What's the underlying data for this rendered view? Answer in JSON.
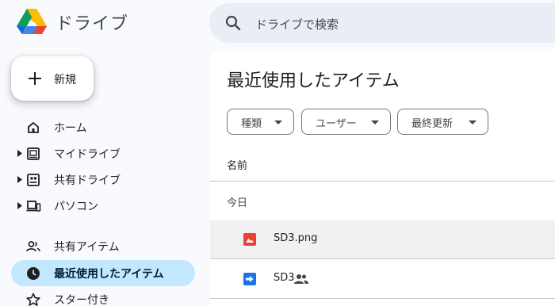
{
  "app": {
    "name": "ドライブ"
  },
  "search": {
    "placeholder": "ドライブで検索"
  },
  "sidebar": {
    "new_button": "新規",
    "items": [
      {
        "label": "ホーム",
        "icon": "home-icon"
      },
      {
        "label": "マイドライブ",
        "icon": "my-drive-icon"
      },
      {
        "label": "共有ドライブ",
        "icon": "shared-drives-icon"
      },
      {
        "label": "パソコン",
        "icon": "computers-icon"
      },
      {
        "label": "共有アイテム",
        "icon": "shared-with-me-icon"
      },
      {
        "label": "最近使用したアイテム",
        "icon": "recent-icon",
        "active": true
      },
      {
        "label": "スター付き",
        "icon": "star-icon"
      }
    ]
  },
  "main": {
    "title": "最近使用したアイテム",
    "filters": [
      "種類",
      "ユーザー",
      "最終更新"
    ],
    "column_name": "名前",
    "section": "今日",
    "files": [
      {
        "name": "SD3.png",
        "icon": "image-file-icon"
      },
      {
        "name": "SD3",
        "icon": "shortcut-file-icon",
        "shared": true
      }
    ]
  },
  "colors": {
    "accent": "#c2e7ff",
    "search_bg": "#e9eef6",
    "image_red": "#ea4335",
    "shortcut_blue": "#1a73e8"
  }
}
